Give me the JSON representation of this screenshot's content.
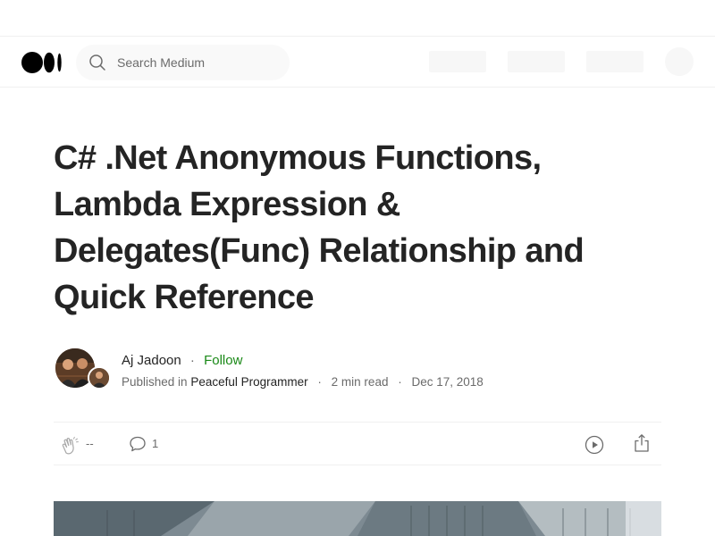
{
  "header": {
    "search_placeholder": "Search Medium"
  },
  "article": {
    "title": "C# .Net Anonymous Functions, Lambda Expression & Delegates(Func) Relationship and Quick Reference",
    "author": "Aj Jadoon",
    "separator": "·",
    "follow_label": "Follow",
    "published_in_label": "Published in",
    "publication": "Peaceful Programmer",
    "read_time": "2 min read",
    "date": "Dec 17, 2018"
  },
  "actions": {
    "clap_count": "--",
    "comment_count": "1"
  },
  "colors": {
    "text": "#242424",
    "muted": "#6b6b6b",
    "follow": "#1a8917",
    "divider": "#f0f0f0"
  },
  "icons": [
    "medium-logo-icon",
    "search-icon",
    "clap-icon",
    "comment-icon",
    "play-icon",
    "share-icon"
  ]
}
